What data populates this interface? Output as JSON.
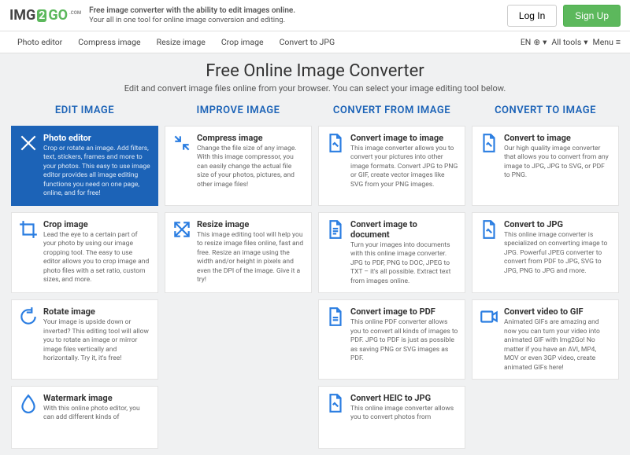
{
  "header": {
    "logo": {
      "img": "IMG",
      "two": "2",
      "go": "GO",
      "dotcom": ".COM"
    },
    "tagline_bold": "Free image converter with the ability to edit images online.",
    "tagline_sub": "Your all in one tool for online image conversion and editing.",
    "login": "Log In",
    "signup": "Sign Up"
  },
  "nav": {
    "items": [
      "Photo editor",
      "Compress image",
      "Resize image",
      "Crop image",
      "Convert to JPG"
    ],
    "lang": "EN",
    "alltools": "All tools",
    "menu": "Menu"
  },
  "main": {
    "title": "Free Online Image Converter",
    "subtitle": "Edit and convert image files online from your browser. You can select your image editing tool below."
  },
  "columns": [
    "EDIT IMAGE",
    "IMPROVE IMAGE",
    "CONVERT FROM IMAGE",
    "CONVERT TO IMAGE"
  ],
  "cards": {
    "edit": [
      {
        "title": "Photo editor",
        "desc": "Crop or rotate an image. Add filters, text, stickers, frames and more to your photos. This easy to use image editor provides all image editing functions you need on one page, online, and for free!"
      },
      {
        "title": "Crop image",
        "desc": "Lead the eye to a certain part of your photo by using our image cropping tool. The easy to use editor allows you to crop image and photo files with a set ratio, custom sizes, and more."
      },
      {
        "title": "Rotate image",
        "desc": "Your image is upside down or inverted? This editing tool will allow you to rotate an image or mirror image files vertically and horizontally. Try it, it's free!"
      },
      {
        "title": "Watermark image",
        "desc": "With this online photo editor, you can add different kinds of"
      }
    ],
    "improve": [
      {
        "title": "Compress image",
        "desc": "Change the file size of any image. With this image compressor, you can easily change the actual file size of your photos, pictures, and other image files!"
      },
      {
        "title": "Resize image",
        "desc": "This image editing tool will help you to resize image files online, fast and free. Resize an image using the width and/or height in pixels and even the DPI of the image. Give it a try!"
      }
    ],
    "from": [
      {
        "title": "Convert image to image",
        "desc": "This image converter allows you to convert your pictures into other image formats. Convert JPG to PNG or GIF, create vector images like SVG from your PNG images."
      },
      {
        "title": "Convert image to document",
        "desc": "Turn your images into documents with this online image converter. JPG to PDF, PNG to DOC, JPEG to TXT – it's all possible. Extract text from images online."
      },
      {
        "title": "Convert image to PDF",
        "desc": "This online PDF converter allows you to convert all kinds of images to PDF. JPG to PDF is just as possible as saving PNG or SVG images as PDF."
      },
      {
        "title": "Convert HEIC to JPG",
        "desc": "This online image converter allows you to convert photos from"
      }
    ],
    "to": [
      {
        "title": "Convert to image",
        "desc": "Our high quality image converter that allows you to convert from any image to JPG, JPG to SVG, or PDF to PNG."
      },
      {
        "title": "Convert to JPG",
        "desc": "This online image converter is specialized on converting image to JPG. Powerful JPEG converter to convert from PDF to JPG, SVG to JPG, PNG to JPG and more."
      },
      {
        "title": "Convert video to GIF",
        "desc": "Animated GIFs are amazing and now you can turn your video into animated GIF with Img2Go! No matter if you have an AVI, MP4, MOV or even 3GP video, create animated GIFs here!"
      }
    ]
  }
}
